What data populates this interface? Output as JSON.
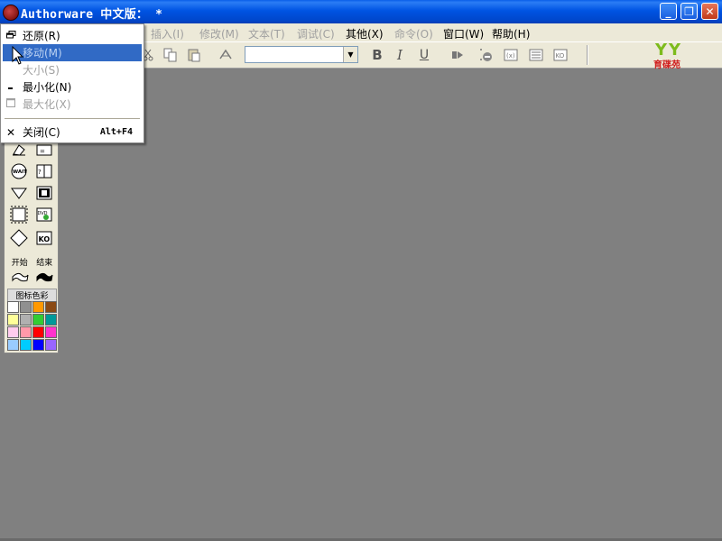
{
  "window": {
    "title": "Authorware 中文版： *",
    "controls": {
      "minimize": "_",
      "maximize": "❐",
      "close": "✕"
    }
  },
  "menubar": {
    "items": [
      {
        "label": "插入(I)",
        "enabled": false
      },
      {
        "label": "修改(M)",
        "enabled": false
      },
      {
        "label": "文本(T)",
        "enabled": false
      },
      {
        "label": "调试(C)",
        "enabled": false
      },
      {
        "label": "其他(X)",
        "enabled": true
      },
      {
        "label": "命令(O)",
        "enabled": false
      },
      {
        "label": "窗口(W)",
        "enabled": true
      },
      {
        "label": "帮助(H)",
        "enabled": true
      }
    ]
  },
  "toolbar": {
    "font_box_value": "",
    "bold": "B",
    "italic": "I",
    "underline": "U",
    "logo_mark": "YY",
    "logo_text": "育碟苑"
  },
  "system_menu": {
    "items": [
      {
        "label": "还原(R)",
        "glyph": "restore-icon",
        "enabled": true,
        "selected": false,
        "shortcut": ""
      },
      {
        "label": "移动(M)",
        "glyph": "",
        "enabled": false,
        "selected": true,
        "shortcut": ""
      },
      {
        "label": "大小(S)",
        "glyph": "",
        "enabled": false,
        "selected": false,
        "shortcut": ""
      },
      {
        "label": "最小化(N)",
        "glyph": "minimize-icon",
        "enabled": true,
        "selected": false,
        "shortcut": ""
      },
      {
        "label": "最大化(X)",
        "glyph": "maximize-icon",
        "enabled": false,
        "selected": false,
        "shortcut": ""
      },
      {
        "label": "关闭(C)",
        "glyph": "close-icon",
        "enabled": true,
        "selected": false,
        "shortcut": "Alt+F4"
      }
    ]
  },
  "palette": {
    "icons": [
      "erase-icon",
      "wait-icon",
      "navigate-icon",
      "framework-icon",
      "decision-icon",
      "calc-icon",
      "interaction-icon",
      "movie-icon",
      "dvd-icon",
      "ko-icon"
    ],
    "wait_text": "WAIT",
    "dvd_text": "DVD",
    "ko_text": "KO",
    "flag_labels": [
      "开始",
      "结束"
    ],
    "color_label": "图标色彩",
    "colors": [
      "#ffffff",
      "#909090",
      "#ff9900",
      "#8a4a14",
      "#ffff99",
      "#b0b0b0",
      "#33cc33",
      "#009999",
      "#ffccee",
      "#ff99aa",
      "#ff0000",
      "#ff33cc",
      "#99ccff",
      "#00ccff",
      "#0000ff",
      "#9966ff"
    ]
  }
}
